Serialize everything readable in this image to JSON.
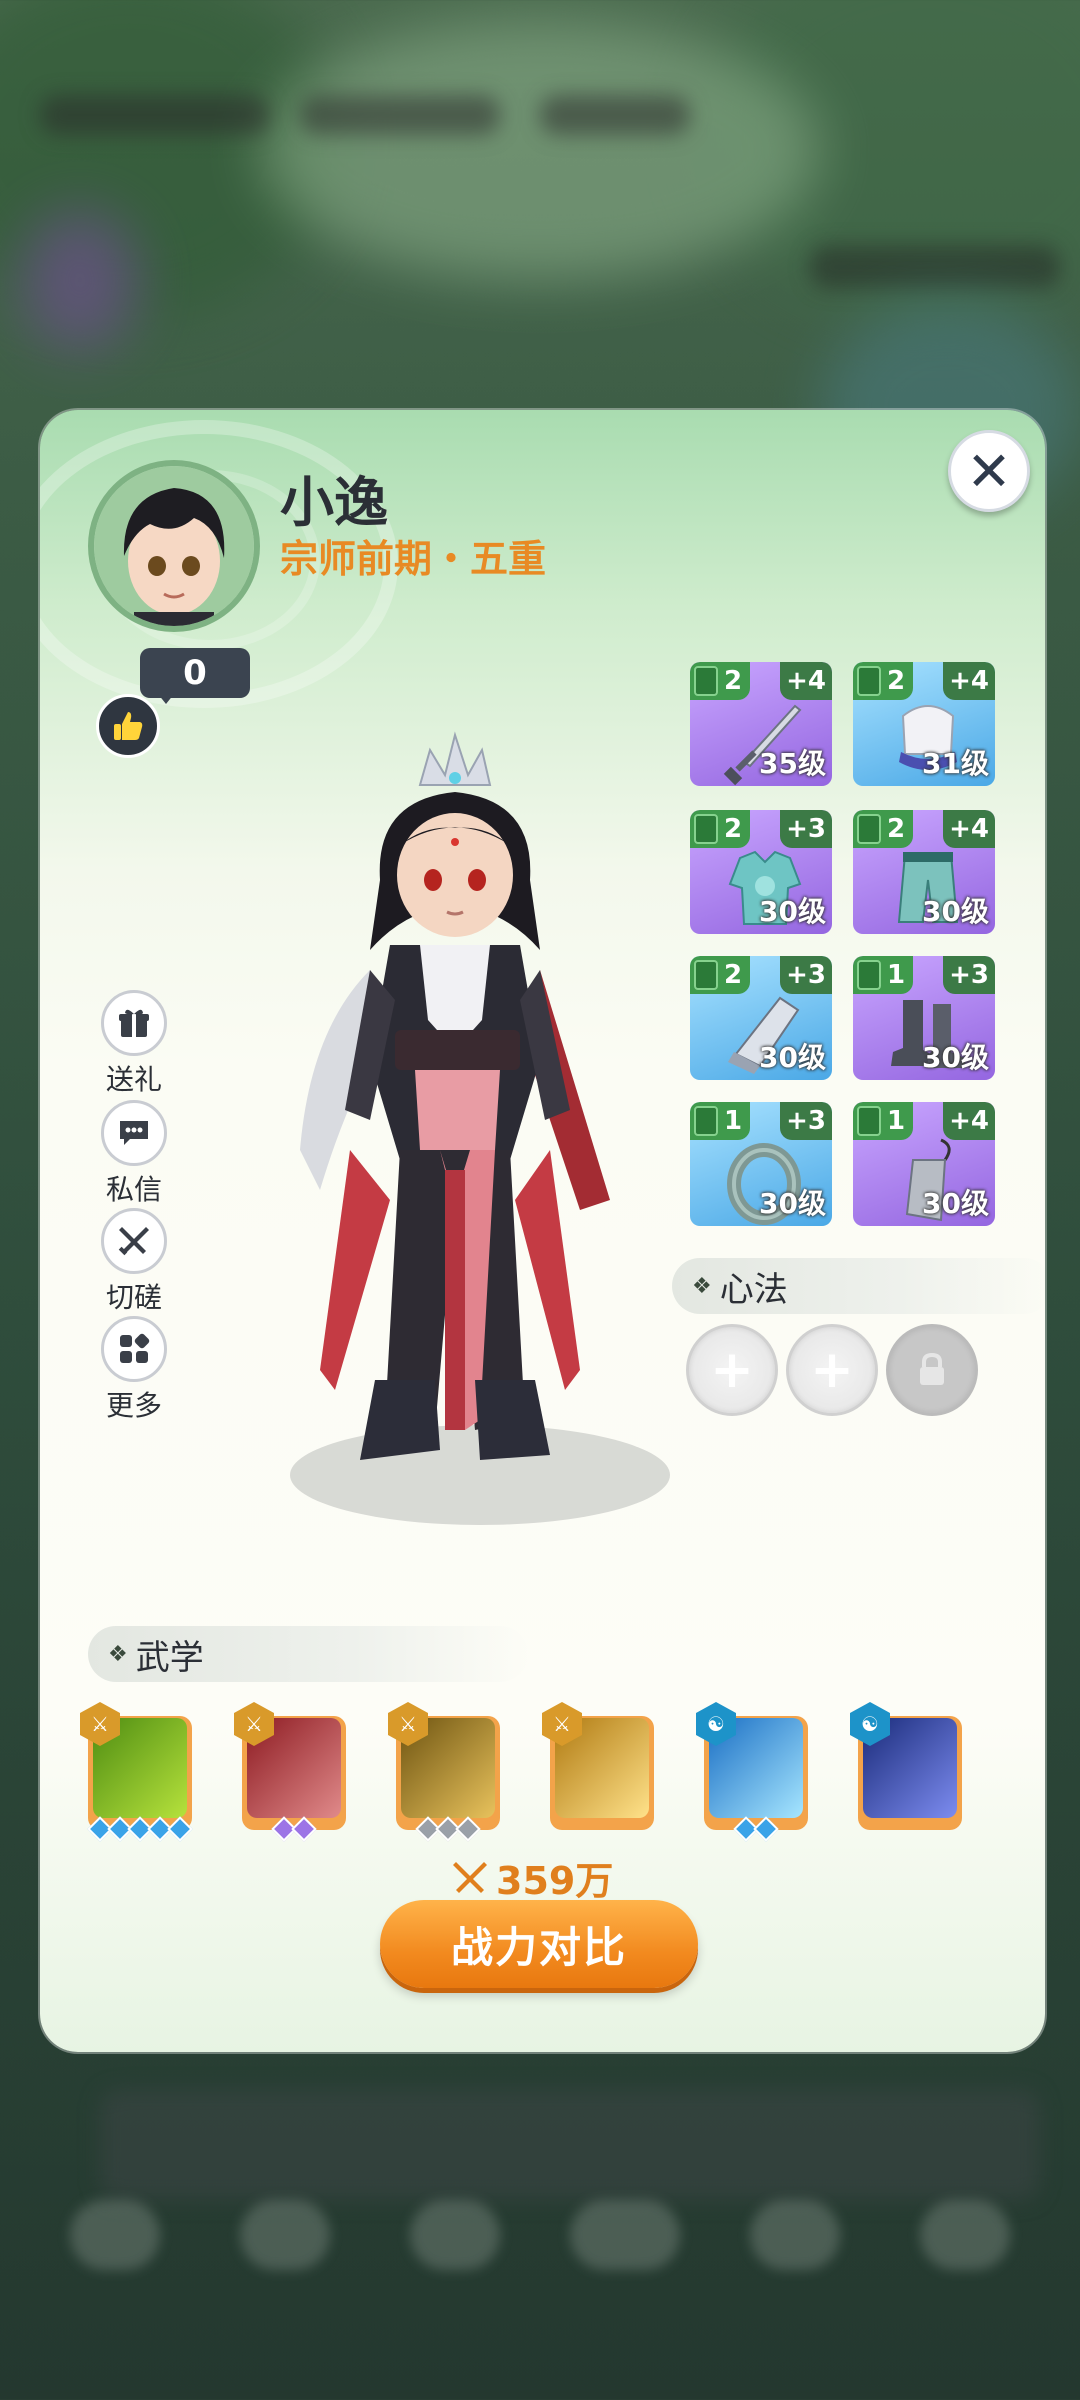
{
  "profile": {
    "name": "小逸",
    "realm": "宗师前期・五重",
    "likes": "0"
  },
  "side_actions": [
    {
      "label": "送礼",
      "icon": "gift-icon"
    },
    {
      "label": "私信",
      "icon": "chat-icon"
    },
    {
      "label": "切磋",
      "icon": "crossed-swords-icon"
    },
    {
      "label": "更多",
      "icon": "grid-icon"
    }
  ],
  "equipment": [
    {
      "slot": "weapon",
      "tier": "2",
      "enhance": "+4",
      "level": "35级",
      "rarity": "purple",
      "icon": "sword-icon"
    },
    {
      "slot": "helmet",
      "tier": "2",
      "enhance": "+4",
      "level": "31级",
      "rarity": "blue",
      "icon": "headband-icon"
    },
    {
      "slot": "armor",
      "tier": "2",
      "enhance": "+3",
      "level": "30级",
      "rarity": "purple",
      "icon": "robe-icon"
    },
    {
      "slot": "pants",
      "tier": "2",
      "enhance": "+4",
      "level": "30级",
      "rarity": "purple",
      "icon": "pants-icon"
    },
    {
      "slot": "bracer",
      "tier": "2",
      "enhance": "+3",
      "level": "30级",
      "rarity": "blue",
      "icon": "bracer-icon"
    },
    {
      "slot": "boots",
      "tier": "1",
      "enhance": "+3",
      "level": "30级",
      "rarity": "purple",
      "icon": "boots-icon"
    },
    {
      "slot": "ring",
      "tier": "1",
      "enhance": "+3",
      "level": "30级",
      "rarity": "blue",
      "icon": "ring-icon"
    },
    {
      "slot": "pendant",
      "tier": "1",
      "enhance": "+4",
      "level": "30级",
      "rarity": "purple",
      "icon": "pendant-icon"
    }
  ],
  "heart_method": {
    "title": "心法",
    "slots": [
      "add",
      "add",
      "locked"
    ]
  },
  "martial_arts": {
    "title": "武学",
    "skills": [
      {
        "type": "gold",
        "colors": [
          "#4f8d12",
          "#b6e23c"
        ],
        "pips": "blue",
        "pip_count": 5
      },
      {
        "type": "gold",
        "colors": [
          "#8d1b22",
          "#e08a8a"
        ],
        "pips": "purple",
        "pip_count": 2
      },
      {
        "type": "gold",
        "colors": [
          "#6e5411",
          "#e8c25c"
        ],
        "pips": "grey",
        "pip_count": 3
      },
      {
        "type": "gold",
        "colors": [
          "#b07a12",
          "#ffe28a"
        ],
        "pips": "grey",
        "pip_count": 0
      },
      {
        "type": "cyan",
        "colors": [
          "#1b6fc4",
          "#a6e6ff"
        ],
        "pips": "blue",
        "pip_count": 2
      },
      {
        "type": "cyan",
        "colors": [
          "#1a2b7a",
          "#7d8cf0"
        ],
        "pips": "grey",
        "pip_count": 0
      }
    ]
  },
  "power": {
    "value": "359万"
  },
  "buttons": {
    "compare": "战力对比",
    "close": "✕"
  }
}
